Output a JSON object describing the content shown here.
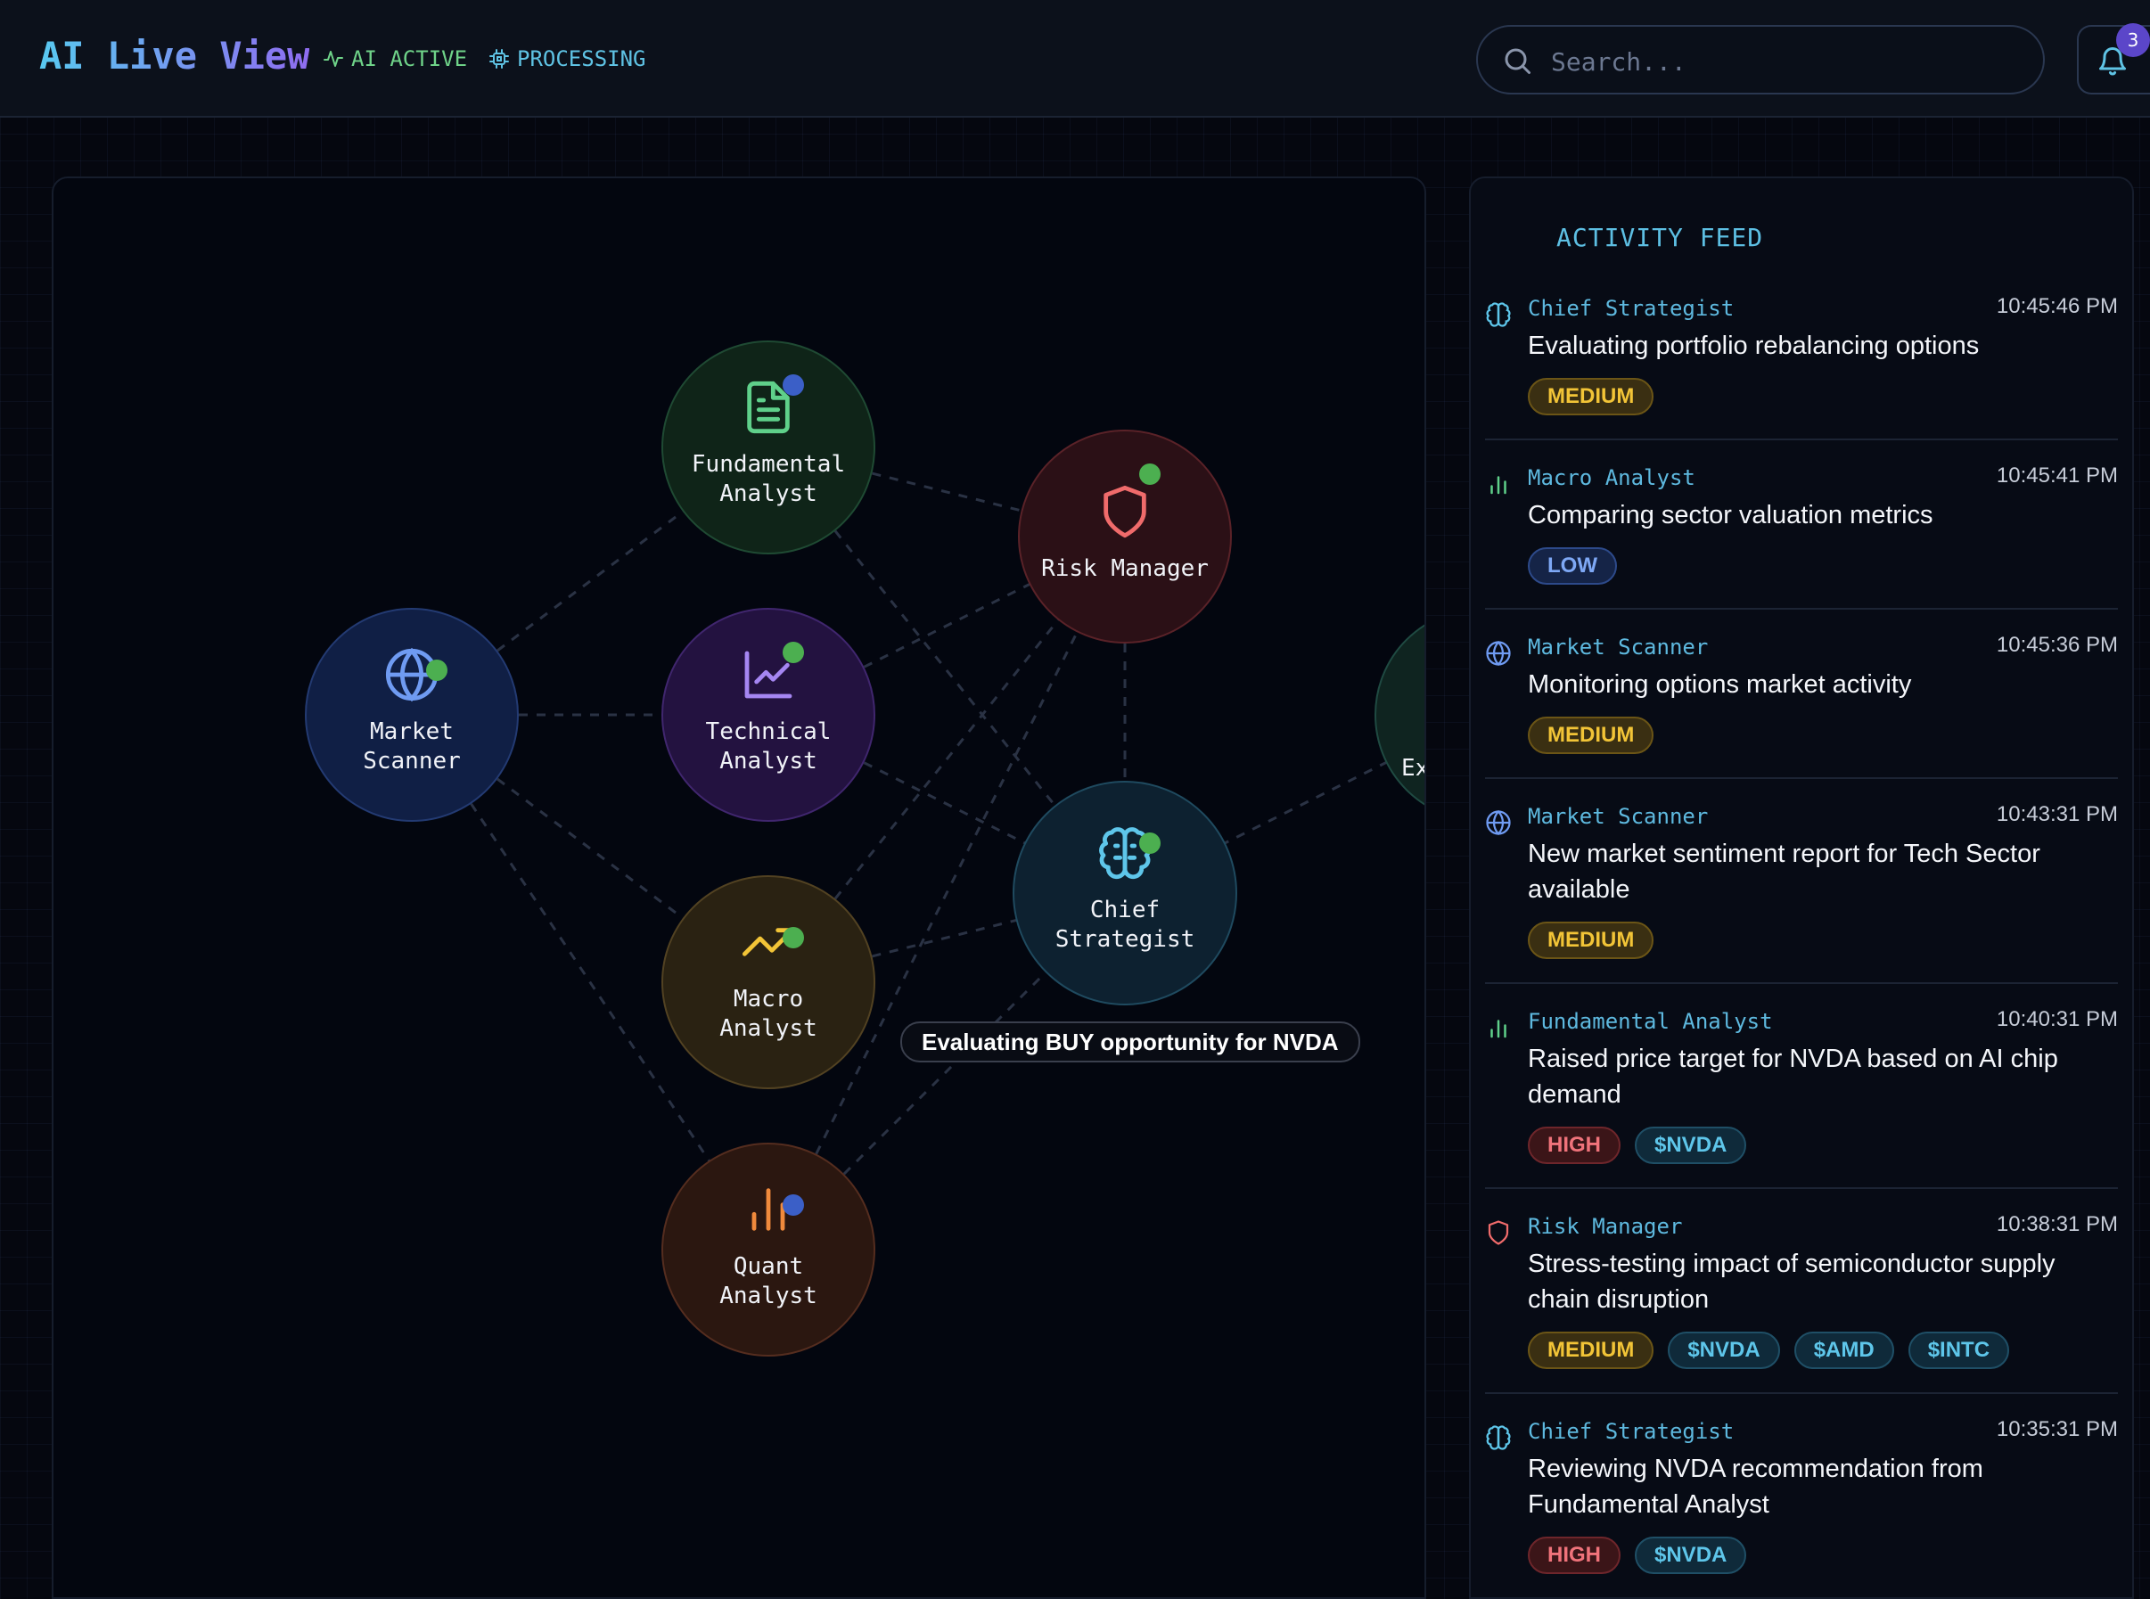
{
  "header": {
    "title": "AI Live View",
    "status_active": "AI ACTIVE",
    "status_processing": "PROCESSING",
    "search_placeholder": "Search...",
    "notification_count": "3"
  },
  "network": {
    "nodes": [
      {
        "id": "fundamental",
        "label": "Fundamental Analyst",
        "icon": "document-icon",
        "color": "#5fd08a",
        "status_color": "#3b5fc7"
      },
      {
        "id": "risk",
        "label": "Risk Manager",
        "icon": "shield-icon",
        "color": "#f06b6b",
        "status_color": "#4caf50"
      },
      {
        "id": "market",
        "label": "Market Scanner",
        "icon": "globe-icon",
        "color": "#6f9bf2",
        "status_color": "#4caf50"
      },
      {
        "id": "technical",
        "label": "Technical Analyst",
        "icon": "line-chart-icon",
        "color": "#a586f2",
        "status_color": "#4caf50"
      },
      {
        "id": "chief",
        "label": "Chief Strategist",
        "icon": "brain-icon",
        "color": "#5ec6ea",
        "status_color": "#4caf50"
      },
      {
        "id": "macro",
        "label": "Macro Analyst",
        "icon": "trending-up-icon",
        "color": "#f2c437",
        "status_color": "#4caf50"
      },
      {
        "id": "quant",
        "label": "Quant Analyst",
        "icon": "bar-chart-icon",
        "color": "#f08a3c",
        "status_color": "#3b5fc7"
      },
      {
        "id": "execution",
        "label": "Ex",
        "icon": "",
        "color": "#5fd0a4",
        "status_color": ""
      }
    ],
    "tooltip": "Evaluating BUY opportunity for NVDA"
  },
  "feed": {
    "title": "ACTIVITY FEED",
    "items": [
      {
        "agent": "Chief Strategist",
        "icon": "brain-icon",
        "time": "10:45:46 PM",
        "message": "Evaluating portfolio rebalancing options",
        "tags": [
          {
            "text": "MEDIUM",
            "kind": "medium"
          }
        ]
      },
      {
        "agent": "Macro Analyst",
        "icon": "bar-chart-icon",
        "time": "10:45:41 PM",
        "message": "Comparing sector valuation metrics",
        "tags": [
          {
            "text": "LOW",
            "kind": "low"
          }
        ]
      },
      {
        "agent": "Market Scanner",
        "icon": "globe-icon",
        "time": "10:45:36 PM",
        "message": "Monitoring options market activity",
        "tags": [
          {
            "text": "MEDIUM",
            "kind": "medium"
          }
        ]
      },
      {
        "agent": "Market Scanner",
        "icon": "globe-icon",
        "time": "10:43:31 PM",
        "message": "New market sentiment report for Tech Sector available",
        "tags": [
          {
            "text": "MEDIUM",
            "kind": "medium"
          }
        ]
      },
      {
        "agent": "Fundamental Analyst",
        "icon": "bar-chart-icon",
        "time": "10:40:31 PM",
        "message": "Raised price target for NVDA based on AI chip demand",
        "tags": [
          {
            "text": "HIGH",
            "kind": "high"
          },
          {
            "text": "$NVDA",
            "kind": "ticker"
          }
        ]
      },
      {
        "agent": "Risk Manager",
        "icon": "shield-icon",
        "time": "10:38:31 PM",
        "message": "Stress-testing impact of semiconductor supply chain disruption",
        "tags": [
          {
            "text": "MEDIUM",
            "kind": "medium"
          },
          {
            "text": "$NVDA",
            "kind": "ticker"
          },
          {
            "text": "$AMD",
            "kind": "ticker"
          },
          {
            "text": "$INTC",
            "kind": "ticker"
          }
        ]
      },
      {
        "agent": "Chief Strategist",
        "icon": "brain-icon",
        "time": "10:35:31 PM",
        "message": "Reviewing NVDA recommendation from Fundamental Analyst",
        "tags": [
          {
            "text": "HIGH",
            "kind": "high"
          },
          {
            "text": "$NVDA",
            "kind": "ticker"
          }
        ]
      }
    ]
  },
  "colors": {
    "accent": "#5ec6ea",
    "active_green": "#6fd389",
    "tag_medium": "#f2c437",
    "tag_low": "#7ea8f5",
    "tag_high": "#f0737b"
  }
}
